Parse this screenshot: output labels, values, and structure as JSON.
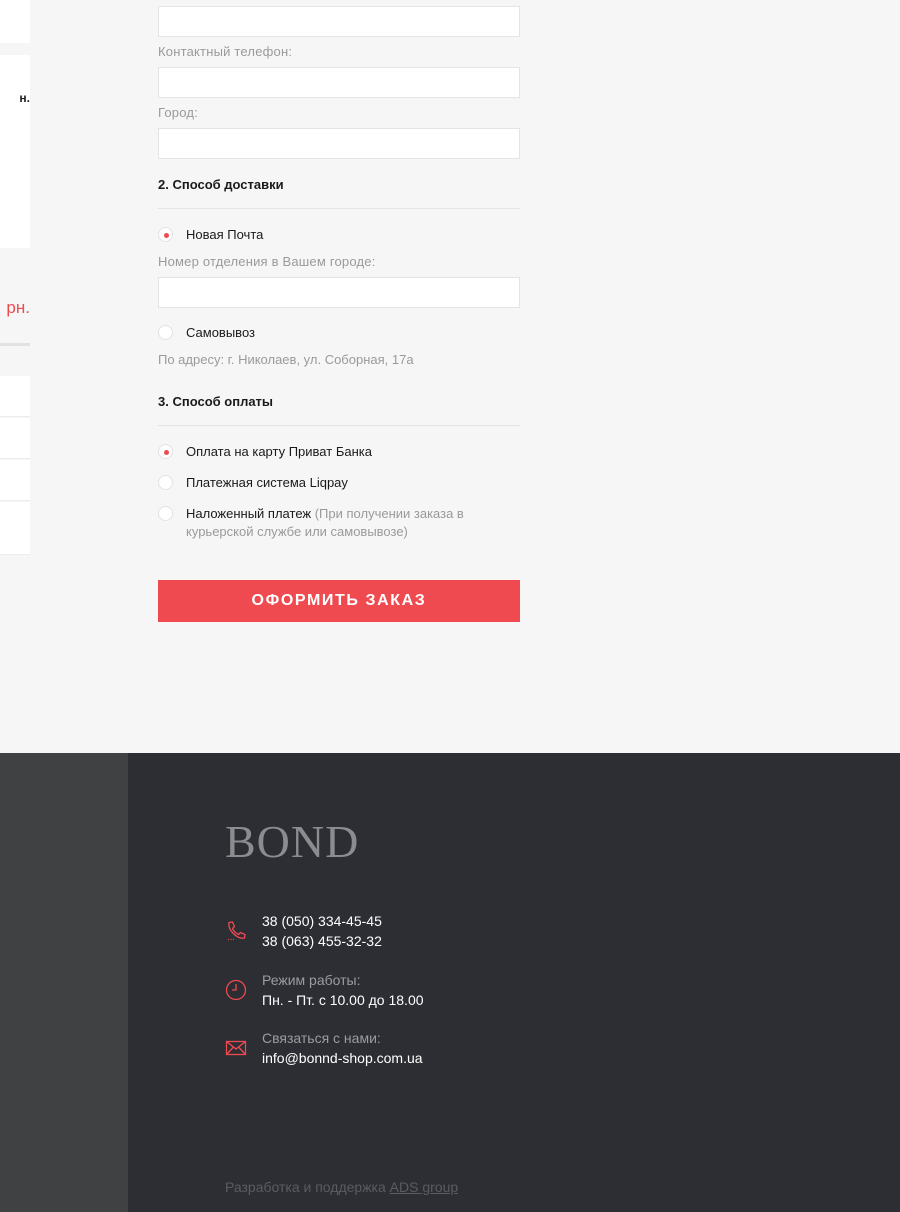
{
  "left_column": {
    "text_fragment": "н.",
    "price_fragment": "рн."
  },
  "form": {
    "phone_label": "Контактный телефон:",
    "city_label": "Город:",
    "delivery_title": "2. Способ доставки",
    "delivery_options": [
      {
        "label": "Новая Почта",
        "checked": true
      },
      {
        "label": "Самовывоз",
        "checked": false
      }
    ],
    "branch_label": "Номер отделения в Вашем городе:",
    "pickup_address": "По адресу: г. Николаев, ул. Соборная, 17а",
    "payment_title": "3. Способ оплаты",
    "payment_options": [
      {
        "label": "Оплата на карту Приват Банка",
        "note": "",
        "checked": true
      },
      {
        "label": "Платежная система Liqpay",
        "note": "",
        "checked": false
      },
      {
        "label": "Наложенный платеж",
        "note": "(При получении заказа в курьерской службе или самовывозе)",
        "checked": false
      }
    ],
    "submit_label": "ОФОРМИТЬ ЗАКАЗ"
  },
  "footer": {
    "logo": "BOND",
    "phones": [
      "38 (050) 334-45-45",
      "38 (063) 455-32-32"
    ],
    "hours_label": "Режим работы:",
    "hours_value": "Пн. - Пт. с 10.00 до 18.00",
    "contact_label": "Связаться с нами:",
    "email": "info@bonnd-shop.com.ua",
    "credits_text": "Разработка и поддержка",
    "credits_link": "ADS group"
  },
  "colors": {
    "accent": "#ef4a50",
    "footer_bg": "#2c2e33",
    "footer_side": "#404143",
    "page_bg": "#f6f6f6"
  }
}
